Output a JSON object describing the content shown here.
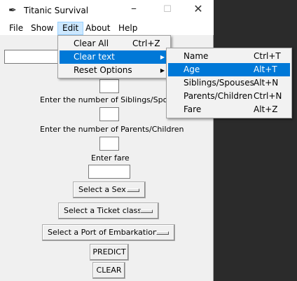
{
  "window": {
    "title": "Titanic Survival"
  },
  "menubar": [
    "File",
    "Show",
    "Edit",
    "About",
    "Help"
  ],
  "form": {
    "siblings_label": "Enter the number of Siblings/Spouses",
    "parents_label": "Enter the number of Parents/Children",
    "fare_label": "Enter fare",
    "sex_select": "Select a Sex",
    "ticket_select": "Select a Ticket class",
    "port_select": "Select a Port of Embarkation",
    "predict_button": "PREDICT",
    "clear_button": "CLEAR"
  },
  "edit_menu": [
    {
      "label": "Clear All",
      "accel": "Ctrl+Z"
    },
    {
      "label": "Clear text",
      "accel": ""
    },
    {
      "label": "Reset Options",
      "accel": ""
    }
  ],
  "clear_text_submenu": [
    {
      "label": "Name",
      "accel": "Ctrl+T"
    },
    {
      "label": "Age",
      "accel": "Alt+T"
    },
    {
      "label": "Siblings/Spouses",
      "accel": "Alt+N"
    },
    {
      "label": "Parents/Children",
      "accel": "Ctrl+N"
    },
    {
      "label": "Fare",
      "accel": "Alt+Z"
    }
  ],
  "colors": {
    "highlight": "#0078d7",
    "menubar_active": "#cce8ff"
  }
}
